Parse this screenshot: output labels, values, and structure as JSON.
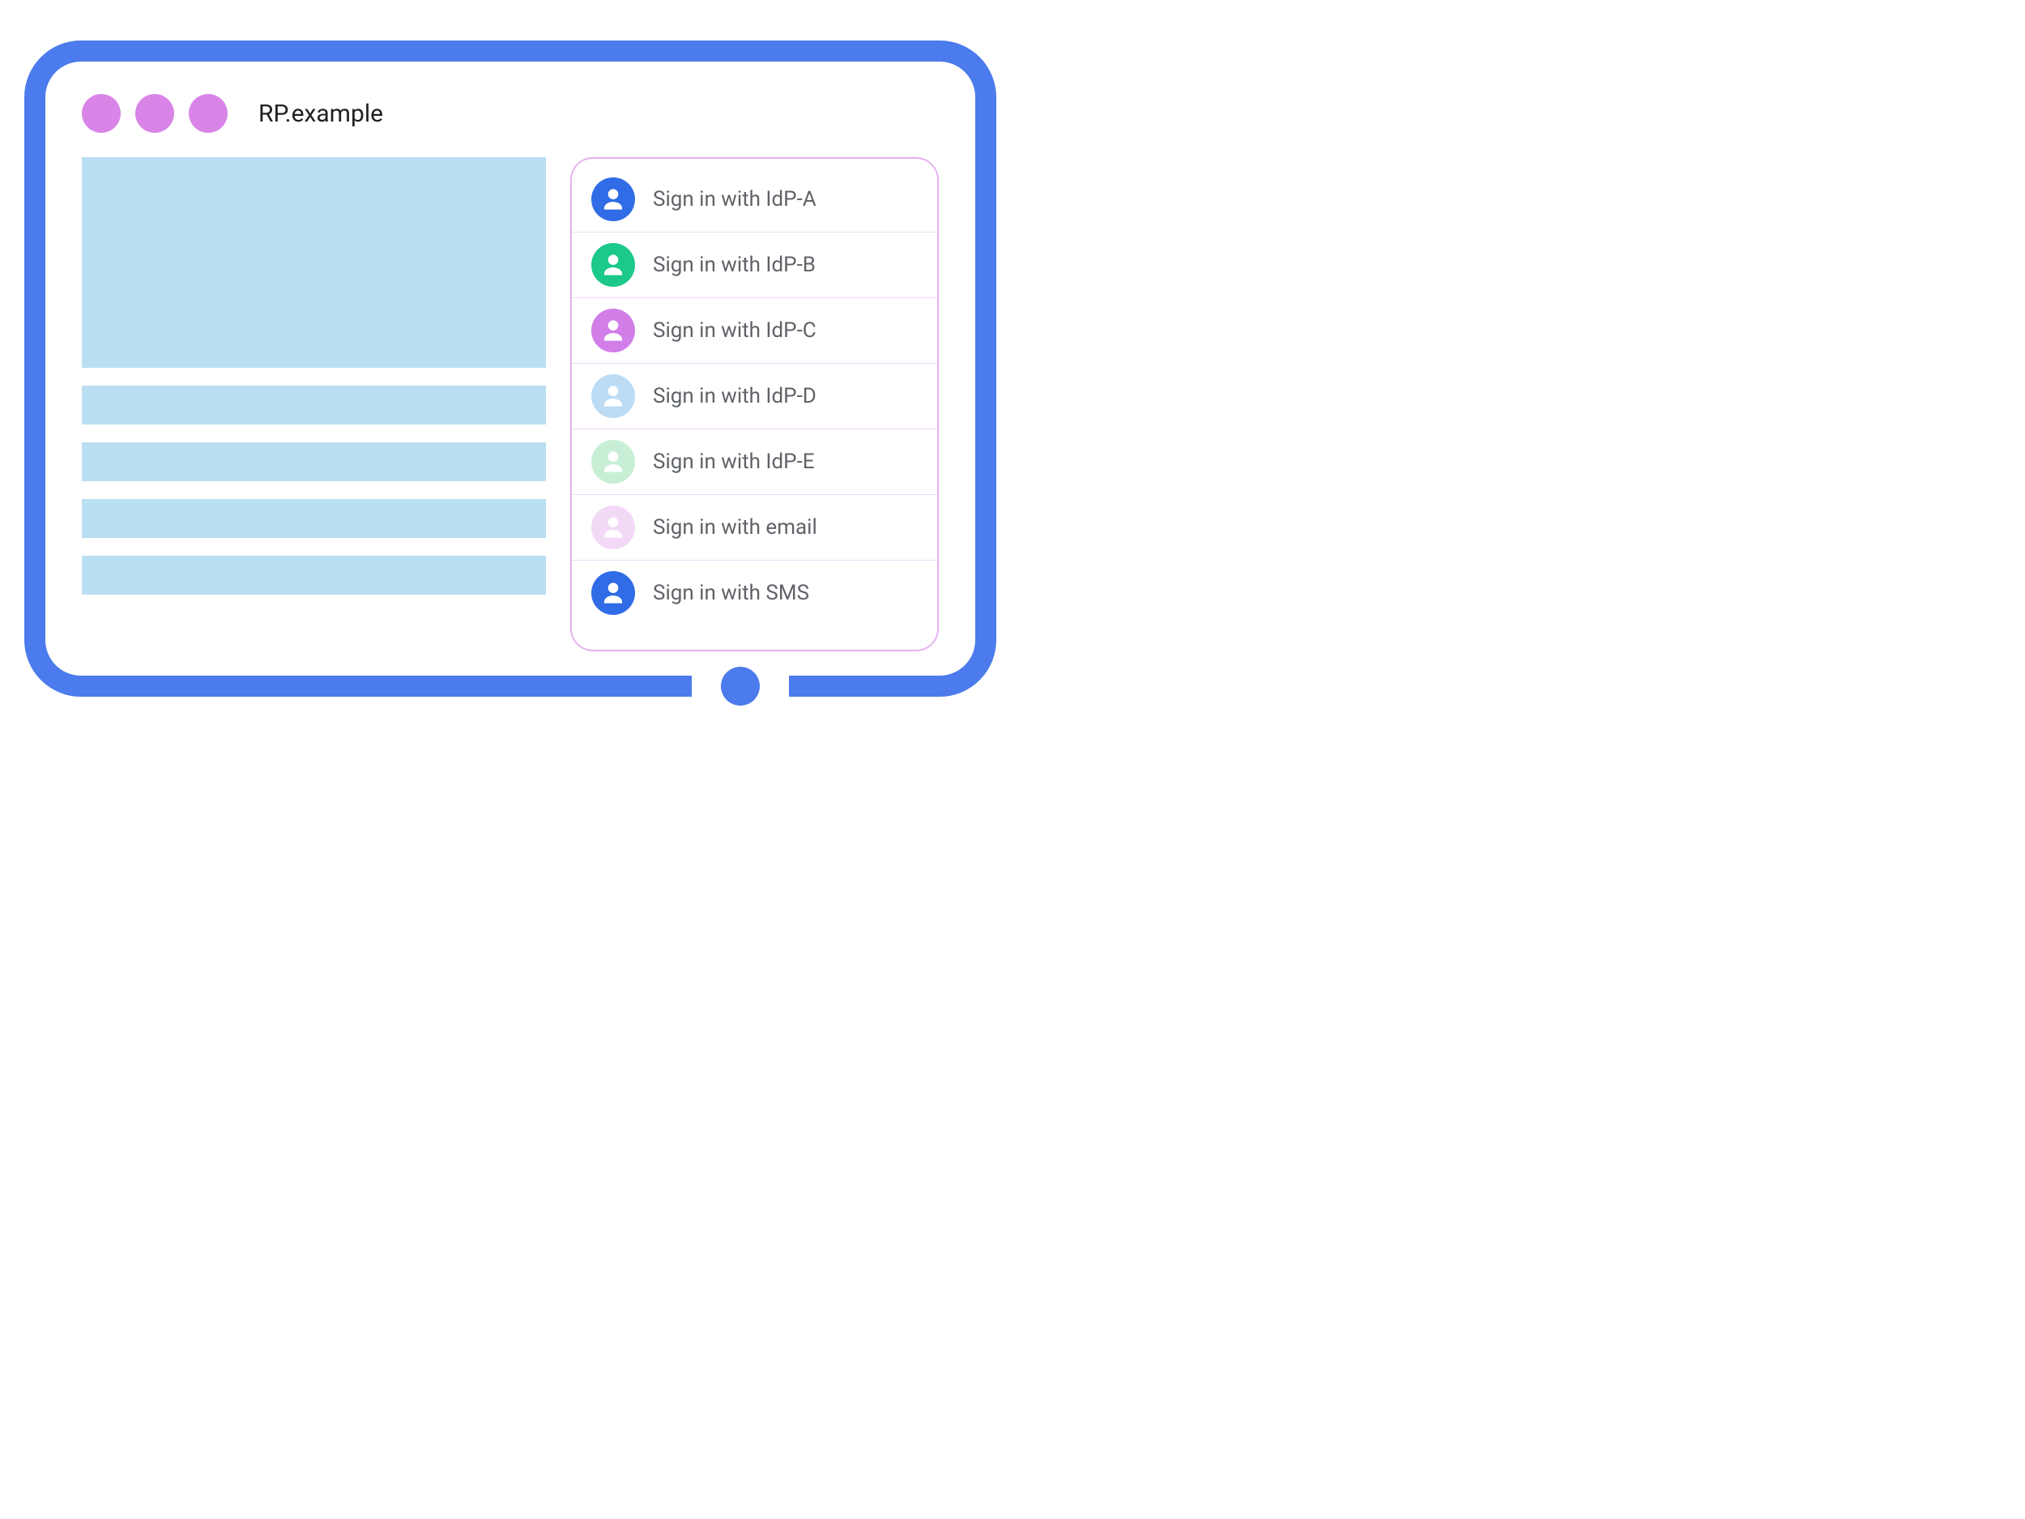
{
  "browser": {
    "title": "RP.example",
    "dot_color": "#D985E8",
    "frame_color": "#4B7BEC",
    "content_block_color": "#BADEF2"
  },
  "signin_panel": {
    "border_color": "#E5B3F0",
    "options": [
      {
        "label": "Sign in with IdP-A",
        "icon_bg": "#2F6CE5"
      },
      {
        "label": "Sign in with IdP-B",
        "icon_bg": "#1CC88A"
      },
      {
        "label": "Sign in with IdP-C",
        "icon_bg": "#D17EE8"
      },
      {
        "label": "Sign in with IdP-D",
        "icon_bg": "#BDDCF4"
      },
      {
        "label": "Sign in with IdP-E",
        "icon_bg": "#C8EFD6"
      },
      {
        "label": "Sign in with email",
        "icon_bg": "#F2D9F6"
      },
      {
        "label": "Sign in with SMS",
        "icon_bg": "#2F6CE5"
      }
    ]
  }
}
